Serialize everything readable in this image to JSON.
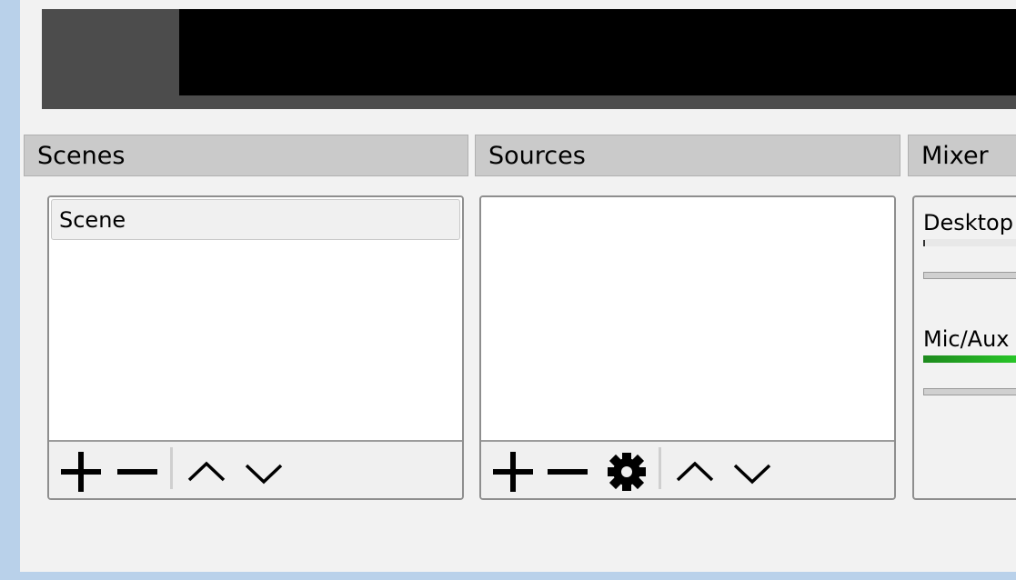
{
  "docks": {
    "scenes": {
      "header": "Scenes",
      "items": [
        "Scene"
      ]
    },
    "sources": {
      "header": "Sources",
      "items": []
    },
    "mixer": {
      "header": "Mixer",
      "channels": [
        {
          "name": "Desktop",
          "level": 0.0
        },
        {
          "name": "Mic/Aux",
          "level": 1.0
        }
      ]
    }
  },
  "icons": {
    "add": "plus-icon",
    "remove": "minus-icon",
    "properties": "gear-icon",
    "move_up": "chevron-up-icon",
    "move_down": "chevron-down-icon"
  },
  "colors": {
    "window_border": "#b9d1ea",
    "preview_bg": "#000000",
    "meter_active": "#28c528"
  }
}
